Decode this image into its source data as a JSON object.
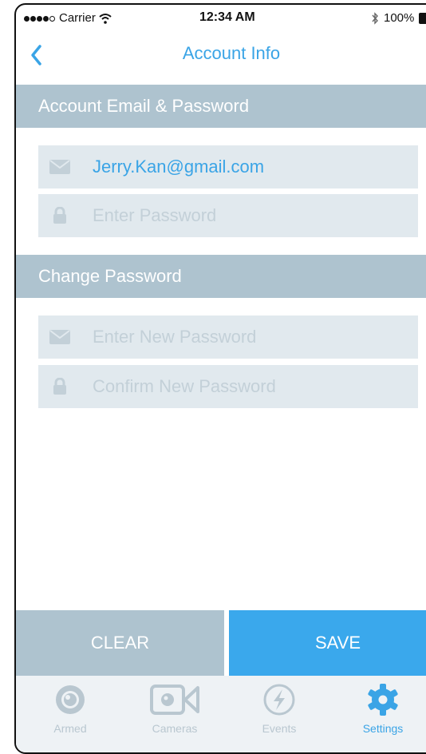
{
  "status_bar": {
    "carrier": "Carrier",
    "time": "12:34 AM",
    "battery": "100%"
  },
  "nav": {
    "title": "Account Info",
    "back_icon": "chevron-left-icon"
  },
  "sections": {
    "account": {
      "title": "Account Email & Password"
    },
    "change": {
      "title": "Change Password"
    }
  },
  "fields": {
    "email": {
      "value": "Jerry.Kan@gmail.com",
      "icon": "mail-icon"
    },
    "password": {
      "placeholder": "Enter Password",
      "icon": "lock-icon"
    },
    "new_password": {
      "placeholder": "Enter New Password",
      "icon": "mail-icon"
    },
    "confirm_password": {
      "placeholder": "Confirm New Password",
      "icon": "lock-icon"
    }
  },
  "actions": {
    "clear": "CLEAR",
    "save": "SAVE"
  },
  "tabs": [
    {
      "label": "Armed",
      "icon": "armed-icon",
      "active": false
    },
    {
      "label": "Cameras",
      "icon": "camera-icon",
      "active": false
    },
    {
      "label": "Events",
      "icon": "lightning-icon",
      "active": false
    },
    {
      "label": "Settings",
      "icon": "gear-icon",
      "active": true
    }
  ],
  "colors": {
    "accent": "#3aa4e6",
    "section_header": "#aec3cf",
    "field_bg": "#e1e9ee",
    "placeholder": "#c3d0d8",
    "inactive_tab": "#b9c7d0"
  }
}
